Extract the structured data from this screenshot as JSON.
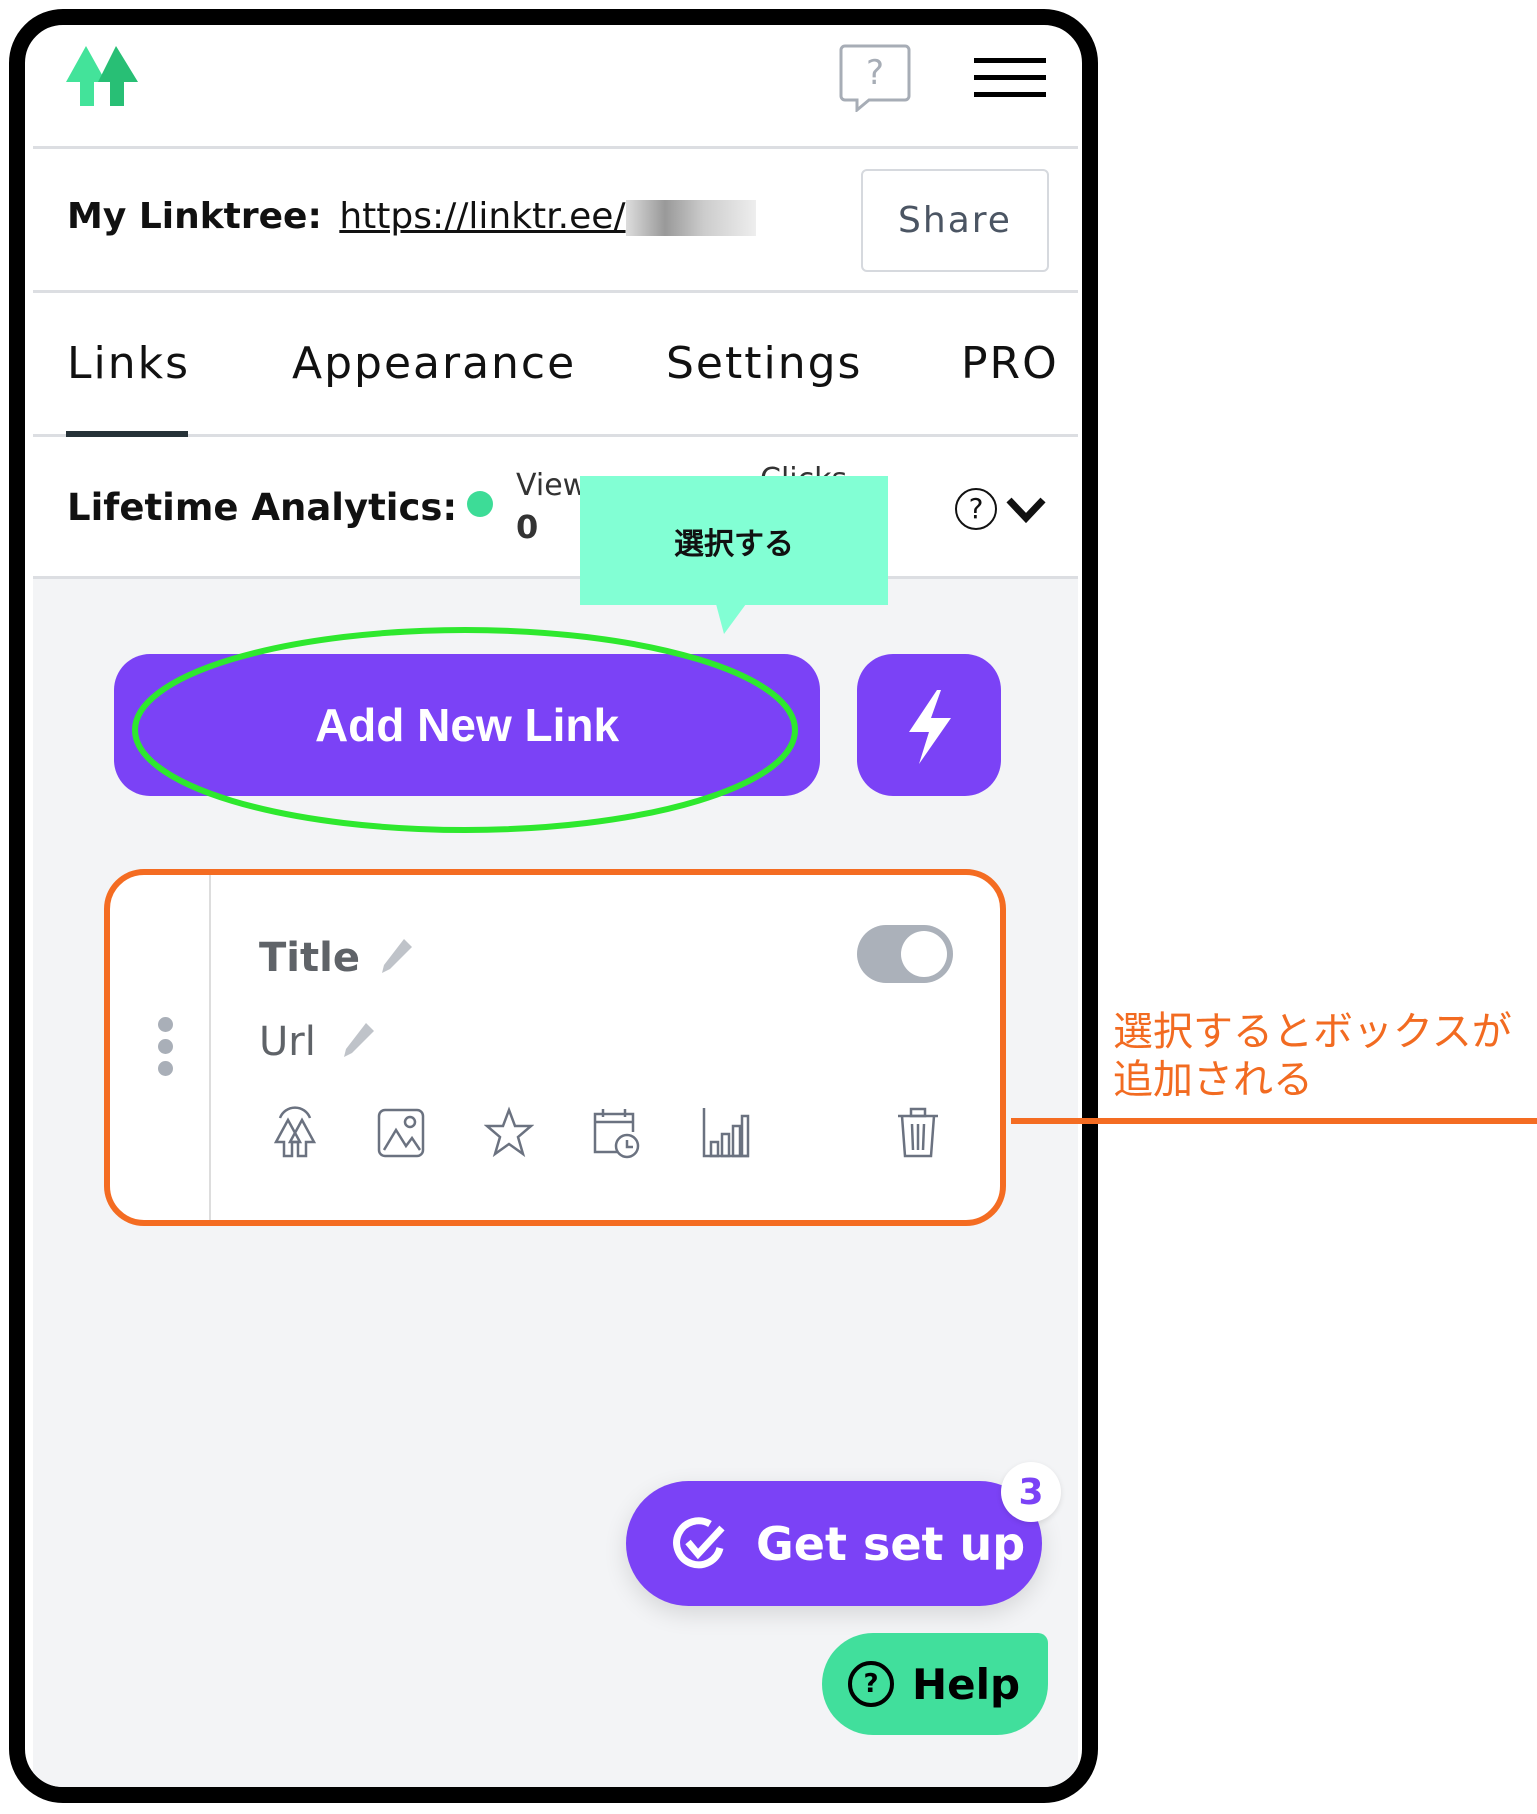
{
  "header": {
    "logo": "linktree-logo",
    "help_icon": "help-bubble-icon",
    "menu_icon": "hamburger-menu-icon"
  },
  "linktree": {
    "label": "My Linktree:",
    "url": "https://linktr.ee/",
    "share_label": "Share"
  },
  "tabs": [
    {
      "label": "Links",
      "active": true
    },
    {
      "label": "Appearance"
    },
    {
      "label": "Settings"
    },
    {
      "label": "PRO"
    }
  ],
  "analytics": {
    "label": "Lifetime Analytics:",
    "views_label": "Views",
    "views_value": "0",
    "clicks_label": "Clicks",
    "status_color": "#3ddc97"
  },
  "tooltip": {
    "text": "選択する",
    "color": "#82ffd4"
  },
  "actions": {
    "add_link_label": "Add New Link",
    "lightning_icon": "lightning-icon",
    "accent": "#7b42f6"
  },
  "link_card": {
    "title": "Title",
    "url": "Url",
    "enabled": false,
    "icons": [
      "linktree-icon",
      "image-icon",
      "star-icon",
      "calendar-clock-icon",
      "analytics-icon",
      "trash-icon"
    ]
  },
  "annotation": {
    "line1": "選択するとボックスが",
    "line2": "追加される",
    "color": "#f26b21"
  },
  "get_set_up": {
    "label": "Get set up",
    "badge": "3"
  },
  "help": {
    "label": "Help",
    "color": "#41df9c"
  }
}
